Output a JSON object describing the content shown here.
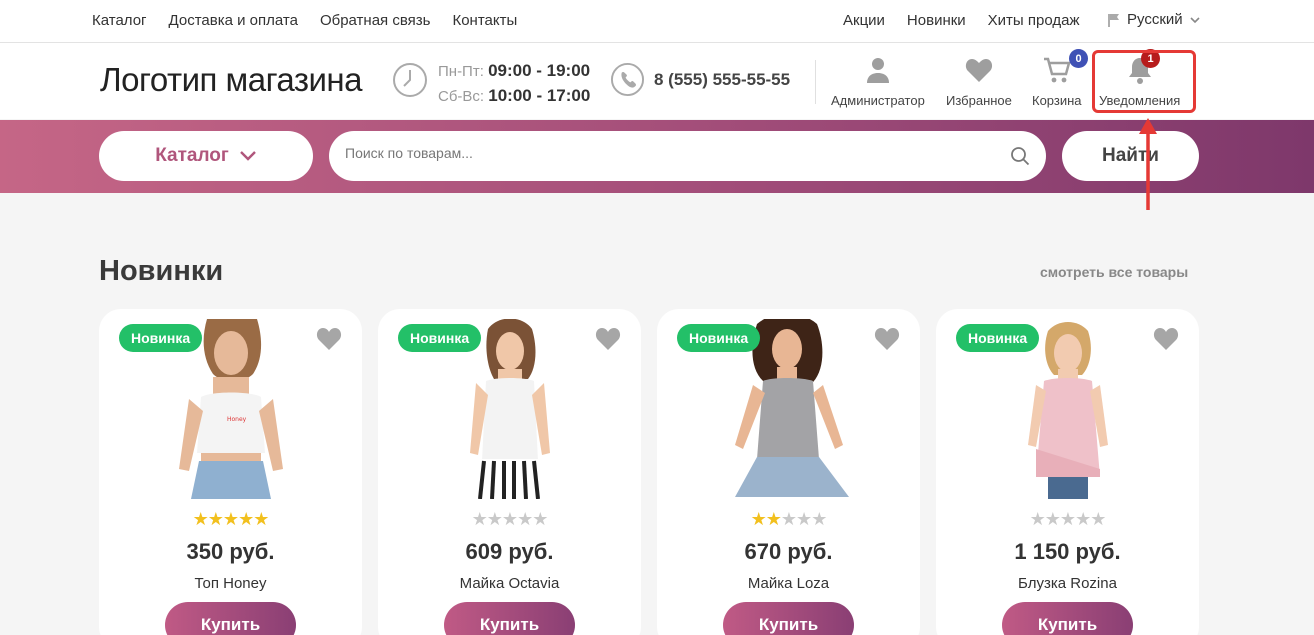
{
  "topbar": {
    "left_links": [
      "Каталог",
      "Доставка и оплата",
      "Обратная связь",
      "Контакты"
    ],
    "right_links": [
      "Акции",
      "Новинки",
      "Хиты продаж"
    ],
    "language": "Русский"
  },
  "header": {
    "logo": "Логотип магазина",
    "hours_weekday_label": "Пн-Пт:",
    "hours_weekday": "09:00 - 19:00",
    "hours_weekend_label": "Сб-Вс:",
    "hours_weekend": "10:00 - 17:00",
    "phone": "8 (555) 555-55-55",
    "admin_label": "Администратор",
    "favorites_label": "Избранное",
    "cart_label": "Корзина",
    "cart_count": "0",
    "notifications_label": "Уведомления",
    "notifications_count": "1"
  },
  "search": {
    "catalog_label": "Каталог",
    "placeholder": "Поиск по товарам...",
    "button_label": "Найти"
  },
  "section": {
    "title": "Новинки",
    "see_all": "смотреть все товары"
  },
  "products": [
    {
      "badge": "Новинка",
      "rating": 5,
      "price": "350 руб.",
      "name": "Топ Honey",
      "buy": "Купить"
    },
    {
      "badge": "Новинка",
      "rating": 0,
      "price": "609 руб.",
      "name": "Майка Octavia",
      "buy": "Купить"
    },
    {
      "badge": "Новинка",
      "rating": 2,
      "price": "670 руб.",
      "name": "Майка Loza",
      "buy": "Купить"
    },
    {
      "badge": "Новинка",
      "rating": 0,
      "price": "1 150 руб.",
      "name": "Блузка Rozina",
      "buy": "Купить"
    }
  ],
  "colors": {
    "accent": "#b0567c",
    "badge_green": "#23c068",
    "notification_badge": "#b71c1c",
    "cart_badge": "#3f51b5",
    "highlight": "#e53935"
  }
}
